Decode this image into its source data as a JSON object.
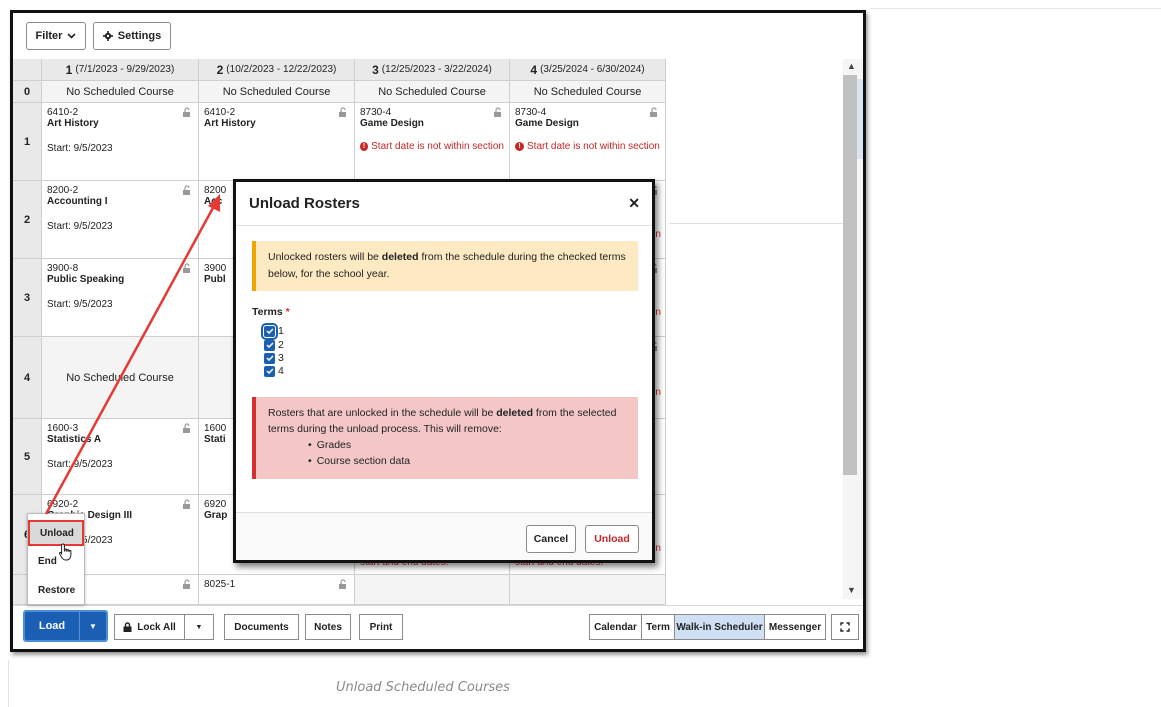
{
  "toolbar": {
    "filter_label": "Filter",
    "settings_label": "Settings"
  },
  "columns": [
    {
      "num": "1",
      "range": "(7/1/2023 - 9/29/2023)"
    },
    {
      "num": "2",
      "range": "(10/2/2023 - 12/22/2023)"
    },
    {
      "num": "3",
      "range": "(12/25/2023 - 3/22/2024)"
    },
    {
      "num": "4",
      "range": "(3/25/2024 - 6/30/2024)"
    }
  ],
  "rows": {
    "r0": {
      "num": "0",
      "text": "No Scheduled Course"
    },
    "r1": {
      "num": "1",
      "c1_code": "6410-2",
      "c1_name": "Art History",
      "c1_start": "Start: 9/5/2023",
      "c2_code": "6410-2",
      "c2_name": "Art History",
      "c3_code": "8730-4",
      "c3_name": "Game Design",
      "c3_warn": "Start date is not within section",
      "c4_code": "8730-4",
      "c4_name": "Game Design",
      "c4_warn": "Start date is not within section"
    },
    "r2": {
      "num": "2",
      "c1_code": "8200-2",
      "c1_name": "Accounting I",
      "c1_start": "Start: 9/5/2023",
      "c2_code": "8200",
      "c2_name": "Acc",
      "c3_tail": "ion",
      "c4_tail": "ion"
    },
    "r3": {
      "num": "3",
      "c1_code": "3900-8",
      "c1_name": "Public Speaking",
      "c1_start": "Start: 9/5/2023",
      "c2_code": "3900",
      "c2_name": "Publ",
      "c3_tail": "ion",
      "c4_tail": "ion"
    },
    "r4": {
      "num": "4",
      "c1_text": "No Scheduled Course",
      "c3_tail": "ion",
      "c4_tail": "ion"
    },
    "r5": {
      "num": "5",
      "c1_code": "1600-3",
      "c1_name": "Statistics A",
      "c1_start": "Start: 9/5/2023",
      "c2_code": "1600",
      "c2_name": "Stati"
    },
    "r6": {
      "num": "6",
      "c1_code": "6920-2",
      "c1_name": "Graphic Design III",
      "c1_start": "Start: 9/5/2023",
      "c2_code": "6920",
      "c2_name": "Grap",
      "c3_warn": "start and end dates.",
      "c4_warn": "start and end dates.",
      "c4_tail": "ion"
    },
    "r7": {
      "c1_code": "",
      "c2_code": "8025-1"
    }
  },
  "bottombar": {
    "load_label": "Load",
    "lock_all_label": "Lock All",
    "documents_label": "Documents",
    "notes_label": "Notes",
    "print_label": "Print",
    "calendar_label": "Calendar",
    "term_label": "Term",
    "walkin_label": "Walk-in Scheduler",
    "messenger_label": "Messenger"
  },
  "load_menu": {
    "unload": "Unload",
    "end": "End",
    "restore": "Restore"
  },
  "modal": {
    "title": "Unload Rosters",
    "warn_pre": "Unlocked rosters will be ",
    "warn_bold": "deleted",
    "warn_post": " from the schedule during the checked terms below, for the school year.",
    "terms_label": "Terms",
    "terms_required": "*",
    "terms": [
      "1",
      "2",
      "3",
      "4"
    ],
    "err_pre": "Rosters that are unlocked in the schedule will be ",
    "err_bold": "deleted",
    "err_post": " from the selected terms during the unload process. This will remove:",
    "err_items": [
      "Grades",
      "Course section data"
    ],
    "cancel_label": "Cancel",
    "unload_label": "Unload"
  },
  "caption": "Unload Scheduled Courses",
  "colors": {
    "accent": "#1a5fb4",
    "danger": "#d32f2f",
    "warning": "#f0a500",
    "annotation": "#e53935"
  }
}
